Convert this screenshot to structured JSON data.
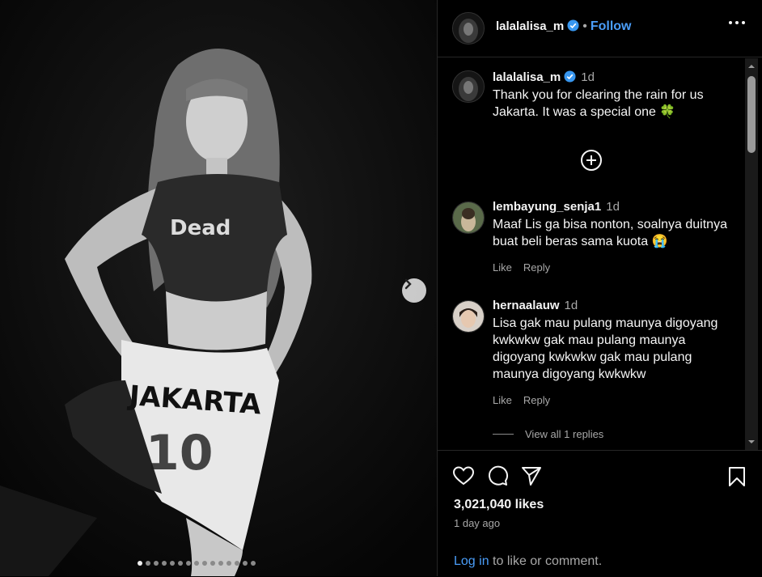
{
  "post": {
    "username": "lalalalisa_m",
    "follow_label": "Follow",
    "caption_time": "1d",
    "caption": "Thank you for clearing the rain for us Jakarta. It was a special one 🍀",
    "shirt_text": "JAKARTA",
    "likes": "3,021,040 likes",
    "posted": "1 day ago",
    "carousel_total": 15,
    "carousel_active": 0
  },
  "comments": [
    {
      "username": "lembayung_senja1",
      "time": "1d",
      "text": "Maaf Lis ga bisa nonton, soalnya duitnya buat beli beras sama kuota 😭",
      "like": "Like",
      "reply": "Reply"
    },
    {
      "username": "hernaalauw",
      "time": "1d",
      "text": "Lisa gak mau pulang maunya digoyang kwkwkw gak mau pulang maunya digoyang kwkwkw gak mau pulang maunya digoyang kwkwkw",
      "like": "Like",
      "reply": "Reply"
    }
  ],
  "view_replies": "View all 1 replies",
  "login": {
    "link": "Log in",
    "rest": " to like or comment."
  },
  "colors": {
    "accent": "#4a9df8",
    "verified": "#3897f0"
  }
}
